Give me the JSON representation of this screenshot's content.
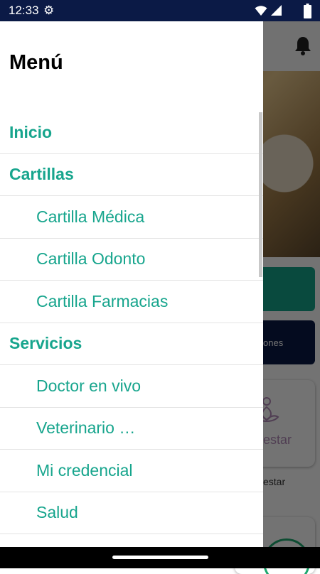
{
  "status_bar": {
    "time": "12:33",
    "icons": [
      "gear-icon",
      "wifi-icon",
      "signal-icon",
      "battery-icon"
    ]
  },
  "background": {
    "app_bar_icons": [
      "bell-icon"
    ],
    "button_text": "ones",
    "card_text": "estar",
    "card_caption": "estar"
  },
  "drawer": {
    "title": "Menú",
    "items": [
      {
        "label": "Inicio",
        "type": "section"
      },
      {
        "label": "Cartillas",
        "type": "section"
      },
      {
        "label": "Cartilla Médica",
        "type": "sub"
      },
      {
        "label": "Cartilla Odonto",
        "type": "sub"
      },
      {
        "label": "Cartilla Farmacias",
        "type": "sub"
      },
      {
        "label": "Servicios",
        "type": "section"
      },
      {
        "label": "Doctor en vivo",
        "type": "sub"
      },
      {
        "label": "Veterinario  …",
        "type": "sub"
      },
      {
        "label": "Mi credencial",
        "type": "sub"
      },
      {
        "label": "Salud",
        "type": "sub"
      }
    ]
  },
  "colors": {
    "accent": "#17a58d",
    "status_bar": "#0b1a46",
    "navy_button": "#0b1a46",
    "teal_button": "#14a58a"
  }
}
